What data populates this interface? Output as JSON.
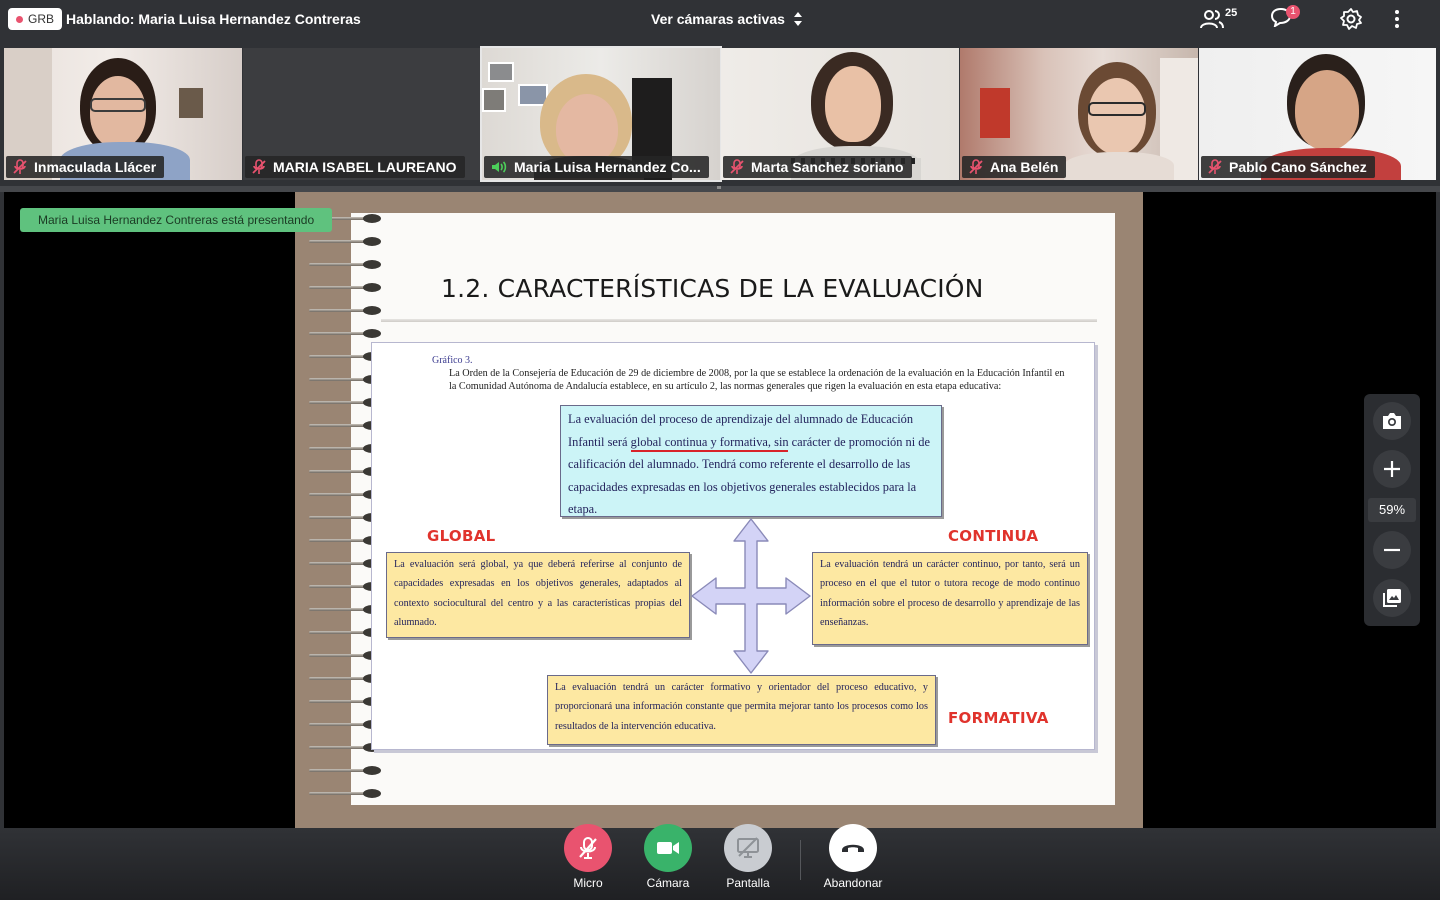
{
  "topbar": {
    "room_code": "GRB",
    "talking": "Hablando: Maria Luisa Hernandez Contreras",
    "cams_toggle": "Ver cámaras activas",
    "participants_count": "25",
    "chat_notifications": "1",
    "icons": [
      "record-dot-icon",
      "sort-icon",
      "participants-icon",
      "chat-icon",
      "settings-icon",
      "more-icon"
    ]
  },
  "participants": [
    {
      "name": "Inmaculada Llácer",
      "status": "muted"
    },
    {
      "name": "MARIA ISABEL LAUREANO",
      "status": "muted"
    },
    {
      "name": "Maria Luisa Hernandez Co...",
      "status": "speaking"
    },
    {
      "name": "Marta Sanchez soriano",
      "status": "muted"
    },
    {
      "name": "Ana Belén",
      "status": "muted"
    },
    {
      "name": "Pablo Cano Sánchez",
      "status": "muted"
    }
  ],
  "presentation": {
    "presenter_badge": "Maria Luisa Hernandez Contreras está presentando",
    "slide_title": "1.2. CARACTERÍSTICAS DE LA EVALUACIÓN",
    "figure_label": "Gráfico 3.",
    "intro": "La Orden de la Consejería de Educación de 29 de diciembre de 2008, por la que se establece la ordenación de la evaluación en la Educación Infantil en la Comunidad Autónoma de Andalucía establece, en su artículo 2, las normas generales que rigen la evaluación en esta etapa educativa:",
    "center_box": {
      "before": "La evaluación del proceso de aprendizaje del alumnado de Educación Infantil será ",
      "highlight": "global continua y formativa",
      "after": ", sin carácter de promoción ni de calificación  del alumnado. Tendrá como referente el desarrollo de las capacidades expresadas en los  objetivos generales establecidos para la etapa."
    },
    "global_label": "GLOBAL",
    "global_text": "La evaluación será global, ya que deberá referirse al conjunto de capacidades expresadas en los objetivos generales, adaptados al contexto sociocultural del centro y a las características propias del alumnado.",
    "continua_label": "CONTINUA",
    "continua_text": "La evaluación tendrá un carácter continuo, por tanto, será un proceso en el que el tutor o tutora recoge de modo continuo información sobre el proceso de  desarrollo y aprendizaje de las enseñanzas.",
    "formativa_label": "FORMATIVA",
    "formativa_text": "La evaluación tendrá un carácter formativo y orientador del proceso educativo, y proporcionará una información constante que permita mejorar tanto los procesos como los resultados de la intervención educativa."
  },
  "zoom": {
    "level": "59%",
    "icons": [
      "camera-icon",
      "zoom-in-icon",
      "zoom-out-icon",
      "gallery-icon"
    ]
  },
  "controls": {
    "mic_label": "Micro",
    "camera_label": "Cámara",
    "screen_label": "Pantalla",
    "leave_label": "Abandonar"
  },
  "colors": {
    "mic_button": "#e9536f",
    "camera_button": "#39b36a",
    "screen_button": "#c9ccd1",
    "leave_button": "#ffffff",
    "presenter_badge": "#5fc27e",
    "speaking_icon": "#4ccf5a",
    "muted_icon": "#e9536f"
  }
}
